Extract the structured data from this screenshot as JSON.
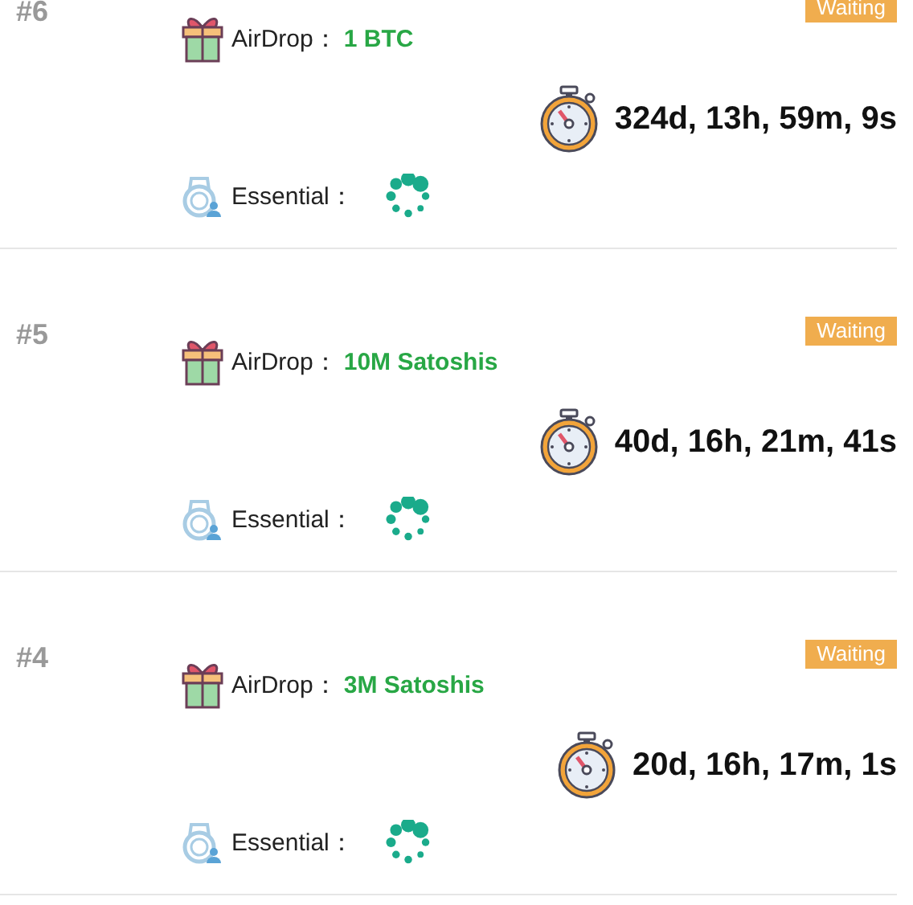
{
  "cards": [
    {
      "number": "#6",
      "status": "Waiting",
      "airdrop_label": "AirDrop：",
      "airdrop_value": "1 BTC",
      "countdown": "324d, 13h, 59m, 9s",
      "essential_label": "Essential："
    },
    {
      "number": "#5",
      "status": "Waiting",
      "airdrop_label": "AirDrop：",
      "airdrop_value": "10M Satoshis",
      "countdown": "40d, 16h, 21m, 41s",
      "essential_label": "Essential："
    },
    {
      "number": "#4",
      "status": "Waiting",
      "airdrop_label": "AirDrop：",
      "airdrop_value": "3M Satoshis",
      "countdown": "20d, 16h, 17m, 1s",
      "essential_label": "Essential："
    }
  ]
}
